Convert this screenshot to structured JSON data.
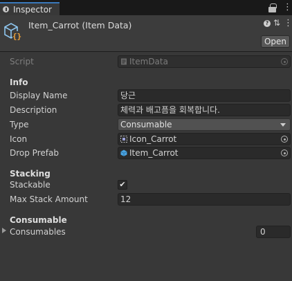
{
  "tab": {
    "label": "Inspector",
    "icon": "info-icon"
  },
  "header": {
    "title": "Item_Carrot (Item Data)",
    "icon": "scriptable-object-icon",
    "open_label": "Open"
  },
  "script_row": {
    "label": "Script",
    "value": "ItemData"
  },
  "sections": {
    "info": "Info",
    "stacking": "Stacking",
    "consumable": "Consumable"
  },
  "fields": {
    "display_name": {
      "label": "Display Name",
      "value": "당근"
    },
    "description": {
      "label": "Description",
      "value": "체력과 배고픔을 회복합니다."
    },
    "type": {
      "label": "Type",
      "value": "Consumable"
    },
    "icon": {
      "label": "Icon",
      "value": "Icon_Carrot"
    },
    "drop_prefab": {
      "label": "Drop Prefab",
      "value": "Item_Carrot"
    },
    "stackable": {
      "label": "Stackable",
      "checked": true,
      "check_glyph": "✔"
    },
    "max_stack": {
      "label": "Max Stack Amount",
      "value": "12"
    },
    "consumables": {
      "label": "Consumables",
      "value": "0"
    }
  },
  "colors": {
    "accent": "#3a79bb",
    "script_icon": "#f0a33a",
    "prefab_icon": "#4aa3e0"
  }
}
